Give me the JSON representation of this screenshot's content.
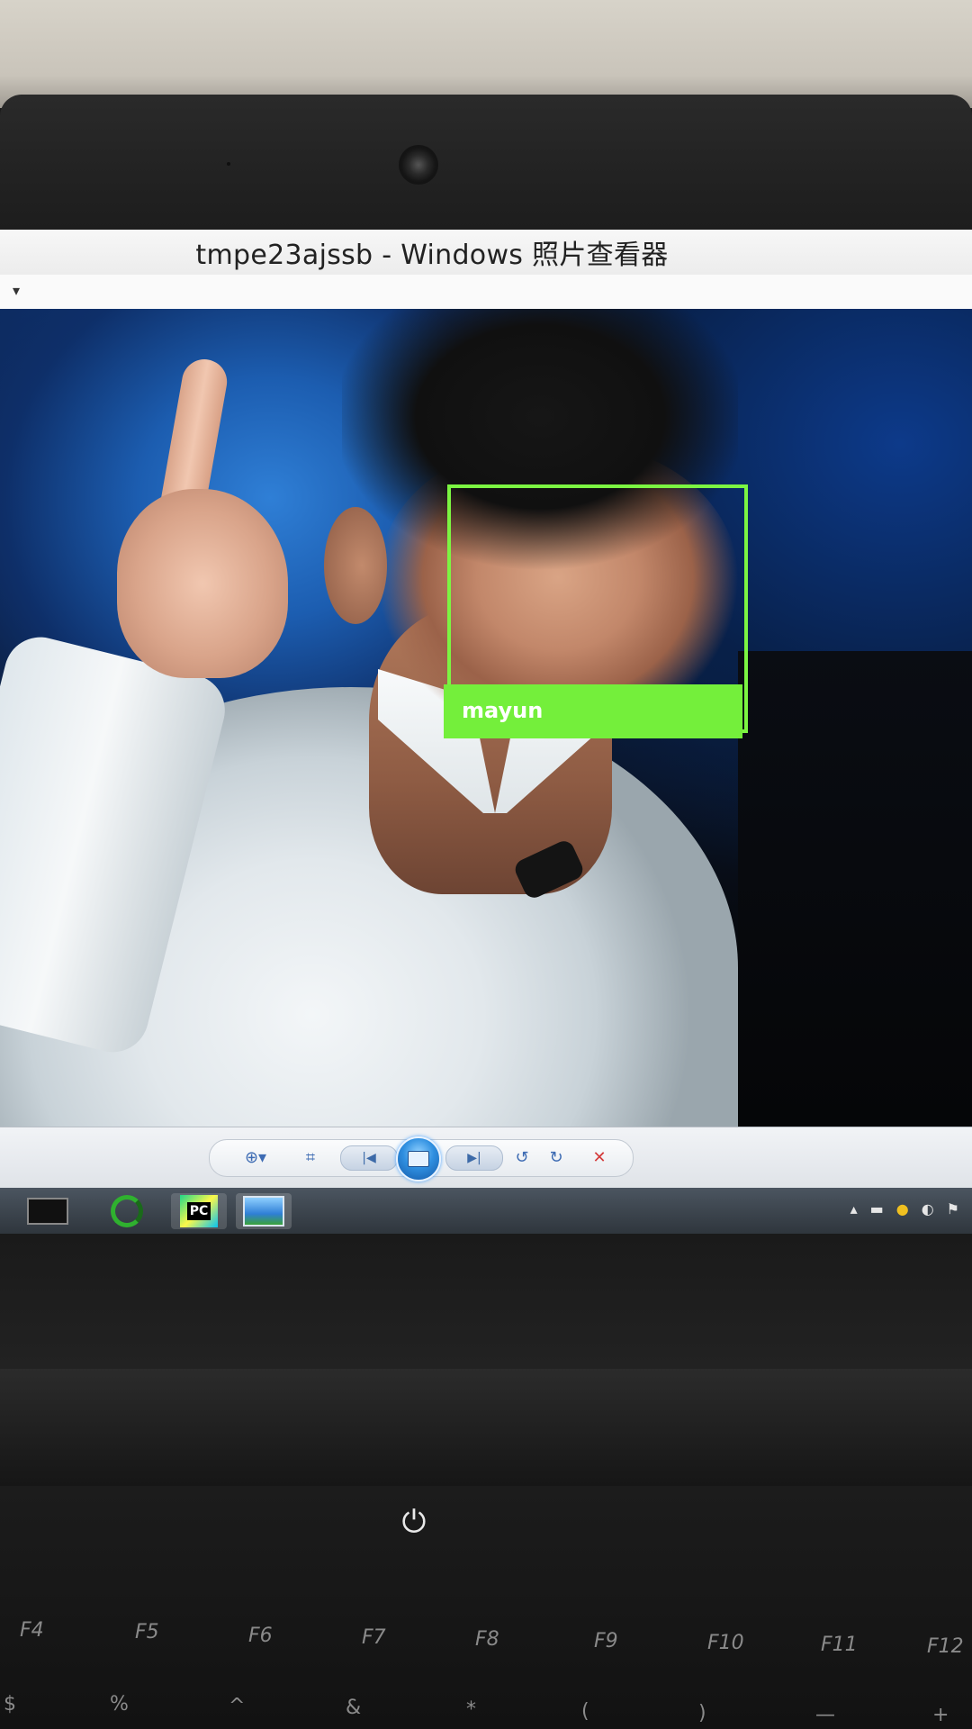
{
  "window": {
    "title": "tmpe23ajssb - Windows 照片查看器",
    "menu_caret": "▾"
  },
  "detection": {
    "label": "mayun",
    "box_color": "#7cf542",
    "label_bg_color": "#74ef3b"
  },
  "toolbar": {
    "zoom_icon": "zoom-icon",
    "fit_icon": "actual-size-icon",
    "prev_icon": "previous-icon",
    "slideshow_icon": "slideshow-icon",
    "next_icon": "next-icon",
    "rotate_ccw_icon": "rotate-counterclockwise-icon",
    "rotate_cw_icon": "rotate-clockwise-icon",
    "delete_icon": "delete-icon",
    "zoom_glyph": "⊕▾",
    "fit_glyph": "⌗",
    "prev_glyph": "|◀",
    "next_glyph": "▶|",
    "rotate_ccw_glyph": "↺",
    "rotate_cw_glyph": "↻",
    "delete_glyph": "✕"
  },
  "taskbar": {
    "pycharm_label": "PC",
    "tray_glyphs": [
      "▴",
      "▬",
      "●",
      "◐",
      "⚑"
    ]
  },
  "keyboard": {
    "power_glyph": "⏻",
    "function_keys": [
      "F4",
      "F5",
      "F6",
      "F7",
      "F8",
      "F9",
      "F10",
      "F11",
      "F12"
    ],
    "number_row": [
      "$",
      "%",
      "^",
      "&",
      "*",
      "(",
      ")",
      "—",
      "+"
    ]
  },
  "colors": {
    "accent_green": "#7cf542",
    "titlebar_bg": "#f2f2f2",
    "toolbar_accent": "#3d6bb3"
  }
}
